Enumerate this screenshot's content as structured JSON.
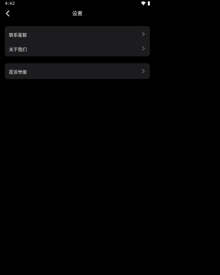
{
  "status_bar": {
    "time": "4:42"
  },
  "nav": {
    "title": "设置"
  },
  "groups": [
    {
      "items": [
        {
          "label": "联系客服"
        },
        {
          "label": "关于我们"
        }
      ]
    },
    {
      "items": [
        {
          "label": "投诉举报"
        }
      ]
    }
  ],
  "colors": {
    "background": "#000000",
    "card": "#1c1c1e",
    "text": "#e6e6e6",
    "chevron": "#7a7a7a"
  },
  "icons": {
    "back": "chevron-left-icon",
    "row_arrow": "chevron-right-icon",
    "wifi": "wifi-icon",
    "battery": "battery-icon"
  }
}
